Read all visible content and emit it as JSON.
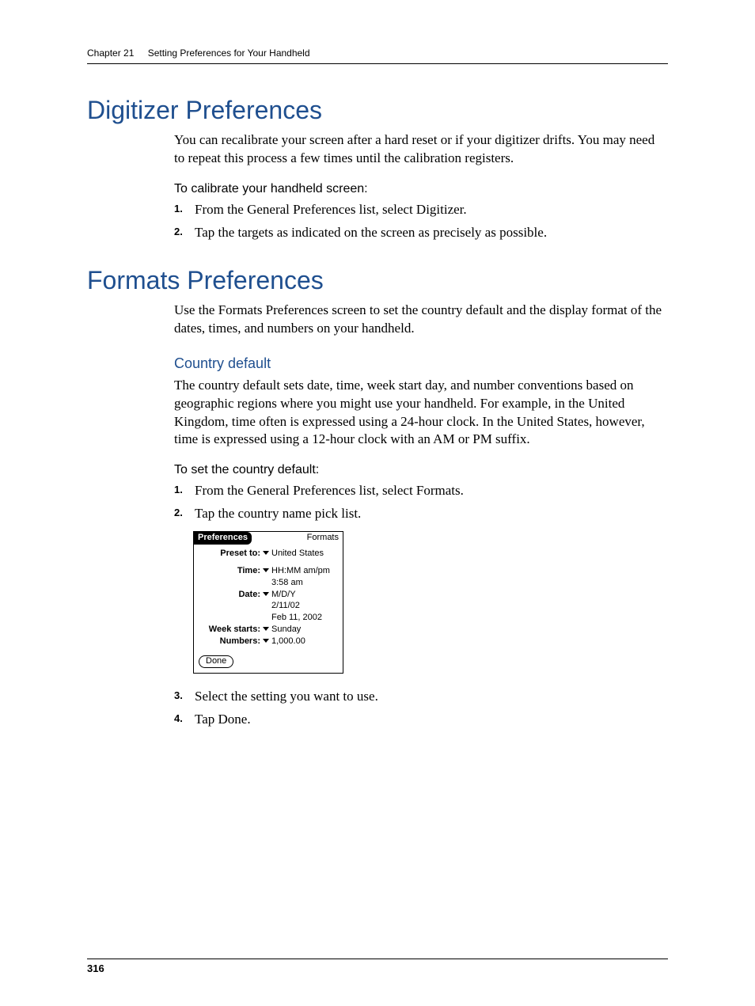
{
  "header": {
    "chapter": "Chapter 21",
    "title": "Setting Preferences for Your Handheld"
  },
  "section1": {
    "title": "Digitizer Preferences",
    "intro": "You can recalibrate your screen after a hard reset or if your digitizer drifts. You may need to repeat this process a few times until the calibration registers.",
    "task_head": "To calibrate your handheld screen:",
    "steps": [
      "From the General Preferences list, select Digitizer.",
      "Tap the targets as indicated on the screen as precisely as possible."
    ]
  },
  "section2": {
    "title": "Formats Preferences",
    "intro": "Use the Formats Preferences screen to set the country default and the display format of the dates, times, and numbers on your handheld.",
    "subhead": "Country default",
    "subtext": "The country default sets date, time, week start day, and number conventions based on geographic regions where you might use your handheld. For example, in the United Kingdom, time often is expressed using a 24-hour clock. In the United States, however, time is expressed using a 12-hour clock with an AM or PM suffix.",
    "task_head": "To set the country default:",
    "steps_a": [
      "From the General Preferences list, select Formats.",
      "Tap the country name pick list."
    ],
    "steps_b": [
      "Select the setting you want to use.",
      "Tap Done."
    ]
  },
  "palm": {
    "title_left": "Preferences",
    "title_right": "Formats",
    "preset_label": "Preset to:",
    "preset_value": "United States",
    "time_label": "Time:",
    "time_value": "HH:MM am/pm",
    "time_example": "3:58 am",
    "date_label": "Date:",
    "date_value": "M/D/Y",
    "date_example1": "2/11/02",
    "date_example2": "Feb 11, 2002",
    "week_label": "Week starts:",
    "week_value": "Sunday",
    "numbers_label": "Numbers:",
    "numbers_value": "1,000.00",
    "done": "Done"
  },
  "footer": {
    "page": "316"
  }
}
